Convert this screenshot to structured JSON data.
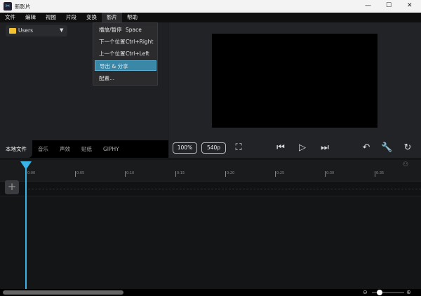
{
  "window": {
    "title": "新影片",
    "controls": [
      "—",
      "☐",
      "✕"
    ]
  },
  "menubar": [
    "文件",
    "编辑",
    "视图",
    "片段",
    "变换",
    "影片",
    "帮助"
  ],
  "dropdown": [
    {
      "label": "播放/暂停",
      "shortcut": "Space"
    },
    {
      "label": "下一个位置",
      "shortcut": "Ctrl+Right"
    },
    {
      "label": "上一个位置",
      "shortcut": "Ctrl+Left"
    },
    {
      "label": "导出 & 分享",
      "shortcut": ""
    },
    {
      "label": "配置...",
      "shortcut": ""
    }
  ],
  "folder": {
    "label": "Users"
  },
  "tabs": [
    "本地文件",
    "音乐",
    "声效",
    "贴纸",
    "GIPHY"
  ],
  "player": {
    "zoom": "100%",
    "resolution": "540p"
  },
  "ruler": [
    "0:00",
    "0:05",
    "0:10",
    "0:15",
    "0:20",
    "0:25",
    "0:30",
    "0:35"
  ],
  "accent": "#3ab4e6"
}
